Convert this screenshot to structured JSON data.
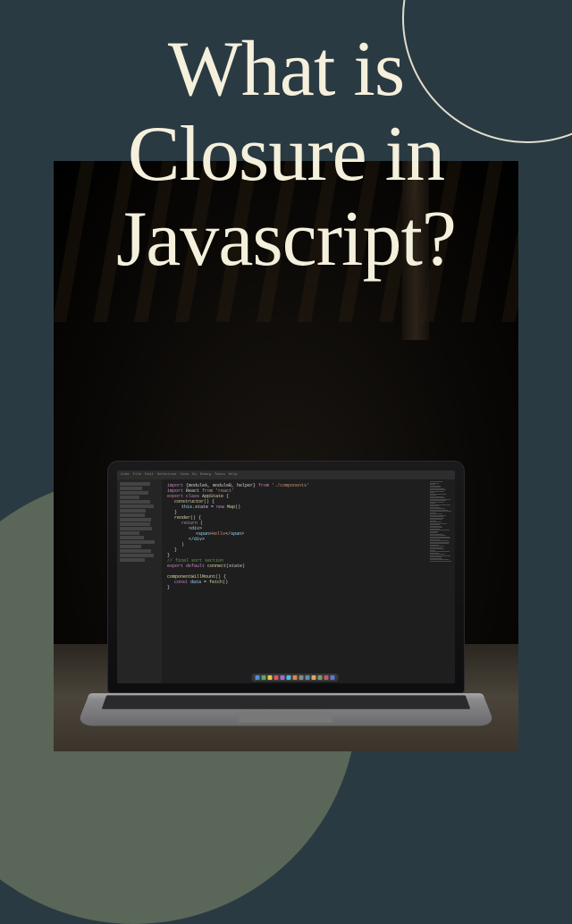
{
  "title": "What is\nClosure in\nJavascript?",
  "colors": {
    "bg_primary": "#2a3a42",
    "bg_accent": "#5a6658",
    "text_cream": "#f5f0dc"
  },
  "laptop": {
    "editor": {
      "menu_items": [
        "Code",
        "File",
        "Edit",
        "Selection",
        "View",
        "Go",
        "Debug",
        "Tasks",
        "Help"
      ],
      "code_snippets": [
        {
          "indent": 0,
          "parts": [
            {
              "cls": "kw",
              "t": "import"
            },
            {
              "cls": "pl",
              "t": " {moduleA, moduleB, helper} "
            },
            {
              "cls": "kw",
              "t": "from"
            },
            {
              "cls": "str",
              "t": " './components'"
            }
          ]
        },
        {
          "indent": 0,
          "parts": [
            {
              "cls": "kw",
              "t": "import"
            },
            {
              "cls": "pl",
              "t": " React "
            },
            {
              "cls": "kw",
              "t": "from"
            },
            {
              "cls": "str",
              "t": " 'react'"
            }
          ]
        },
        {
          "indent": 0,
          "parts": [
            {
              "cls": "kw",
              "t": "export"
            },
            {
              "cls": "pl",
              "t": " "
            },
            {
              "cls": "kw",
              "t": "class"
            },
            {
              "cls": "fn",
              "t": " AppState"
            },
            {
              "cls": "pl",
              "t": " {"
            }
          ]
        },
        {
          "indent": 1,
          "parts": [
            {
              "cls": "fn",
              "t": "constructor"
            },
            {
              "cls": "pl",
              "t": "() {"
            }
          ]
        },
        {
          "indent": 2,
          "parts": [
            {
              "cls": "var",
              "t": "this"
            },
            {
              "cls": "pl",
              "t": ".state = "
            },
            {
              "cls": "kw",
              "t": "new"
            },
            {
              "cls": "fn",
              "t": " Map"
            },
            {
              "cls": "pl",
              "t": "()"
            }
          ]
        },
        {
          "indent": 1,
          "parts": [
            {
              "cls": "pl",
              "t": "}"
            }
          ]
        },
        {
          "indent": 1,
          "parts": [
            {
              "cls": "fn",
              "t": "render"
            },
            {
              "cls": "pl",
              "t": "() {"
            }
          ]
        },
        {
          "indent": 2,
          "parts": [
            {
              "cls": "kw",
              "t": "return"
            },
            {
              "cls": "pl",
              "t": " ("
            }
          ]
        },
        {
          "indent": 3,
          "parts": [
            {
              "cls": "pl",
              "t": "<"
            },
            {
              "cls": "var",
              "t": "div"
            },
            {
              "cls": "pl",
              "t": ">"
            }
          ]
        },
        {
          "indent": 4,
          "parts": [
            {
              "cls": "pl",
              "t": "<"
            },
            {
              "cls": "var",
              "t": "span"
            },
            {
              "cls": "pl",
              "t": ">"
            },
            {
              "cls": "str",
              "t": "Hello"
            },
            {
              "cls": "pl",
              "t": "</"
            },
            {
              "cls": "var",
              "t": "span"
            },
            {
              "cls": "pl",
              "t": ">"
            }
          ]
        },
        {
          "indent": 3,
          "parts": [
            {
              "cls": "pl",
              "t": "</"
            },
            {
              "cls": "var",
              "t": "div"
            },
            {
              "cls": "pl",
              "t": ">"
            }
          ]
        },
        {
          "indent": 2,
          "parts": [
            {
              "cls": "pl",
              "t": ")"
            }
          ]
        },
        {
          "indent": 1,
          "parts": [
            {
              "cls": "pl",
              "t": "}"
            }
          ]
        },
        {
          "indent": 0,
          "parts": [
            {
              "cls": "pl",
              "t": "}"
            }
          ]
        },
        {
          "indent": 0,
          "parts": [
            {
              "cls": "cm",
              "t": "// final sort section"
            }
          ]
        },
        {
          "indent": 0,
          "parts": [
            {
              "cls": "kw",
              "t": "export default"
            },
            {
              "cls": "fn",
              "t": " connect"
            },
            {
              "cls": "pl",
              "t": "(state)"
            }
          ]
        },
        {
          "indent": 0,
          "parts": []
        },
        {
          "indent": 0,
          "parts": [
            {
              "cls": "fn",
              "t": "componentWillMount"
            },
            {
              "cls": "pl",
              "t": "() {"
            }
          ]
        },
        {
          "indent": 1,
          "parts": [
            {
              "cls": "kw",
              "t": "const"
            },
            {
              "cls": "var",
              "t": " data"
            },
            {
              "cls": "pl",
              "t": " = "
            },
            {
              "cls": "fn",
              "t": "fetch"
            },
            {
              "cls": "pl",
              "t": "()"
            }
          ]
        },
        {
          "indent": 0,
          "parts": [
            {
              "cls": "pl",
              "t": "}"
            }
          ]
        }
      ],
      "dock_colors": [
        "#4a90d9",
        "#5ba85b",
        "#e8c547",
        "#d85a5a",
        "#9b6dd7",
        "#4ac0d9",
        "#e87f47",
        "#888",
        "#5b8fa8",
        "#d8a85a",
        "#7a9b6d",
        "#c05a5a",
        "#5a7ad8"
      ]
    }
  }
}
